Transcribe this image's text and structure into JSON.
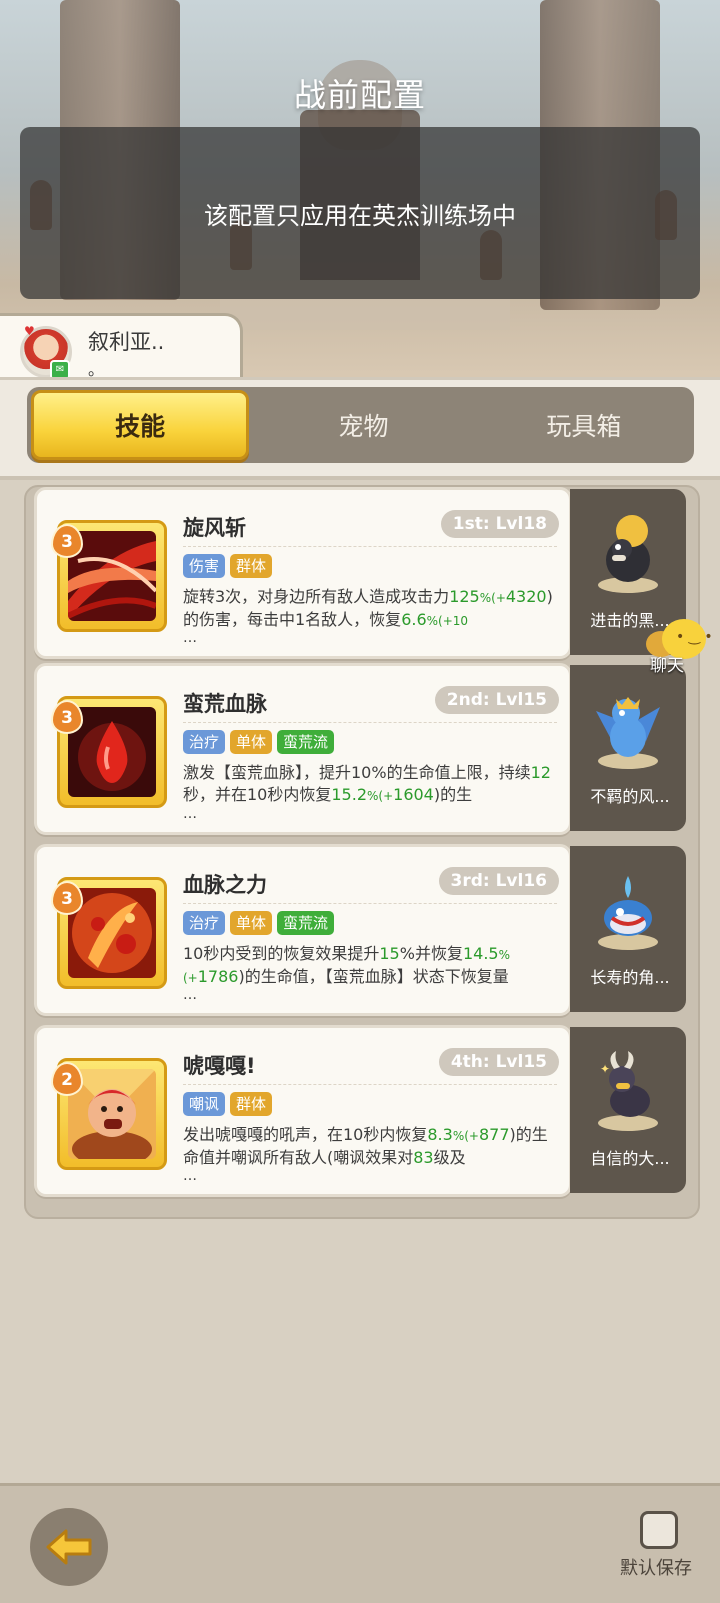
{
  "header": {
    "title": "战前配置",
    "notice": "该配置只应用在英杰训练场中"
  },
  "player": {
    "name": "叙利亚..",
    "sub": "。"
  },
  "tabs": [
    {
      "label": "技能",
      "active": true
    },
    {
      "label": "宠物",
      "active": false
    },
    {
      "label": "玩具箱",
      "active": false
    }
  ],
  "skills": [
    {
      "level": "3",
      "name": "旋风斩",
      "rank": "1st: Lvl18",
      "tags": [
        "伤害",
        "群体"
      ],
      "desc_a": "旋转3次，对身边所有敌人造成攻击力",
      "val1": "125",
      "pct1": "%(+",
      "bonus1": "4320",
      "desc_b": ")的伤害，每击中1名敌人，恢复",
      "val2": "6.6",
      "pct2": "%(+10",
      "more": "…",
      "pet": "进击的黑..."
    },
    {
      "level": "3",
      "name": "蛮荒血脉",
      "rank": "2nd: Lvl15",
      "tags": [
        "治疗",
        "单体",
        "蛮荒流"
      ],
      "desc_a": "激发【蛮荒血脉】，提升10%的生命值上限，持续",
      "val1": "12",
      "desc_b": "秒，并在10秒内恢复",
      "val2": "15.2",
      "pct2": "%(+",
      "bonus2": "1604",
      "desc_c": ")的生",
      "more": "…",
      "pet": "不羁的风..."
    },
    {
      "level": "3",
      "name": "血脉之力",
      "rank": "3rd: Lvl16",
      "tags": [
        "治疗",
        "单体",
        "蛮荒流"
      ],
      "desc_a": "10秒内受到的恢复效果提升",
      "val1": "15",
      "desc_b": "%并恢复",
      "val2": "14.5",
      "pct2": "%(+",
      "bonus2": "1786",
      "desc_c": ")的生命值，【蛮荒血脉】状态下恢复量",
      "more": "…",
      "pet": "长寿的角..."
    },
    {
      "level": "2",
      "name": "唬嘎嘎!",
      "rank": "4th: Lvl15",
      "tags": [
        "嘲讽",
        "群体"
      ],
      "desc_a": "发出唬嘎嘎的吼声，在10秒内恢复",
      "val1": "8.3",
      "pct1": "%(+",
      "bonus1": "877",
      "desc_b": ")的生命值并嘲讽所有敌人(嘲讽效果对",
      "val2": "83",
      "desc_c": "级及",
      "more": "…",
      "pet": "自信的大..."
    }
  ],
  "chat": {
    "label": "聊天"
  },
  "bottom": {
    "save_label": "默认保存"
  },
  "colors": {
    "accent_yellow": "#f9d33b",
    "tag_blue": "#6b98d8",
    "tag_gold": "#e2a62c",
    "tag_green": "#3fae3a",
    "value_green": "#2b9a2b"
  }
}
